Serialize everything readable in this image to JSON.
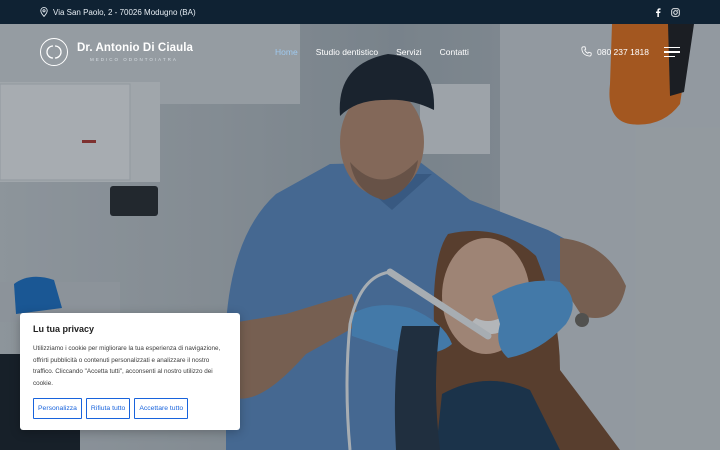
{
  "topbar": {
    "address": "Via San Paolo, 2 - 70026 Modugno (BA)",
    "icons": [
      "map-pin-icon",
      "facebook-icon",
      "instagram-icon"
    ]
  },
  "header": {
    "logo_name": "Dr. Antonio Di Ciaula",
    "logo_subtitle": "MEDICO ODONTOIATRA",
    "menu": [
      "Home",
      "Studio dentistico",
      "Servizi",
      "Contatti"
    ],
    "active_menu": "Home",
    "phone": "080 237 1818",
    "icons": [
      "phone-icon",
      "hamburger-menu-icon"
    ]
  },
  "cookie_banner": {
    "title": "Lu tua privacy",
    "text": "Utilizziamo i cookie per migliorare la tua esperienza di navigazione, offrirti pubblicità o contenuti personalizzati e analizzare il nostro traffico. Cliccando \"Accetta tutti\", acconsenti al nostro utilizzo dei cookie.",
    "buttons": {
      "customize": "Personalizza",
      "reject": "Rifiuta tutto",
      "accept": "Accettare tutto"
    }
  },
  "colors": {
    "topbar": "#0f2233",
    "active_link": "#9ec9ef",
    "button_blue": "#1863dc",
    "scrubs": "#5d8dc4",
    "gloves": "#5aa6e6"
  }
}
